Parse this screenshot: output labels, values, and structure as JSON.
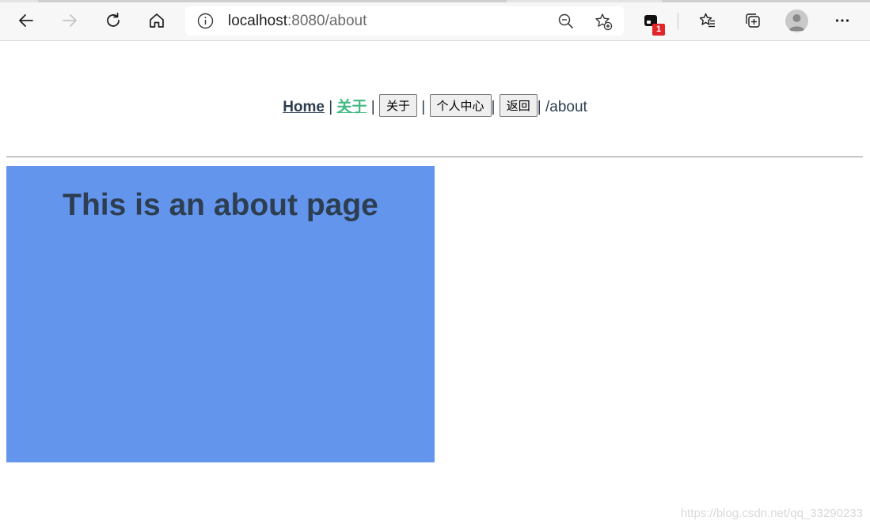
{
  "browser": {
    "url_host": "localhost",
    "url_rest": ":8080/about",
    "extension_badge": "1",
    "icons": {
      "back": "arrow-left-icon",
      "forward": "arrow-right-icon",
      "refresh": "refresh-icon",
      "home": "home-icon",
      "site_info": "info-icon",
      "zoom": "zoom-out-icon",
      "add_favorite": "star-add-icon",
      "extension": "extension-icon",
      "favorites": "favorites-list-icon",
      "collections": "collections-icon",
      "profile": "avatar",
      "menu": "more-icon"
    }
  },
  "nav": {
    "home_link": "Home",
    "about_link": "关于",
    "separator": "|",
    "about_button": "关于",
    "profile_button": "个人中心",
    "back_button": "返回",
    "route_path": "/about"
  },
  "main": {
    "heading": "This is an about page"
  },
  "watermark": "https://blog.csdn.net/qq_33290233",
  "colors": {
    "text": "#2c3e50",
    "active_link": "#42b983",
    "about_box": "#6495ed"
  }
}
